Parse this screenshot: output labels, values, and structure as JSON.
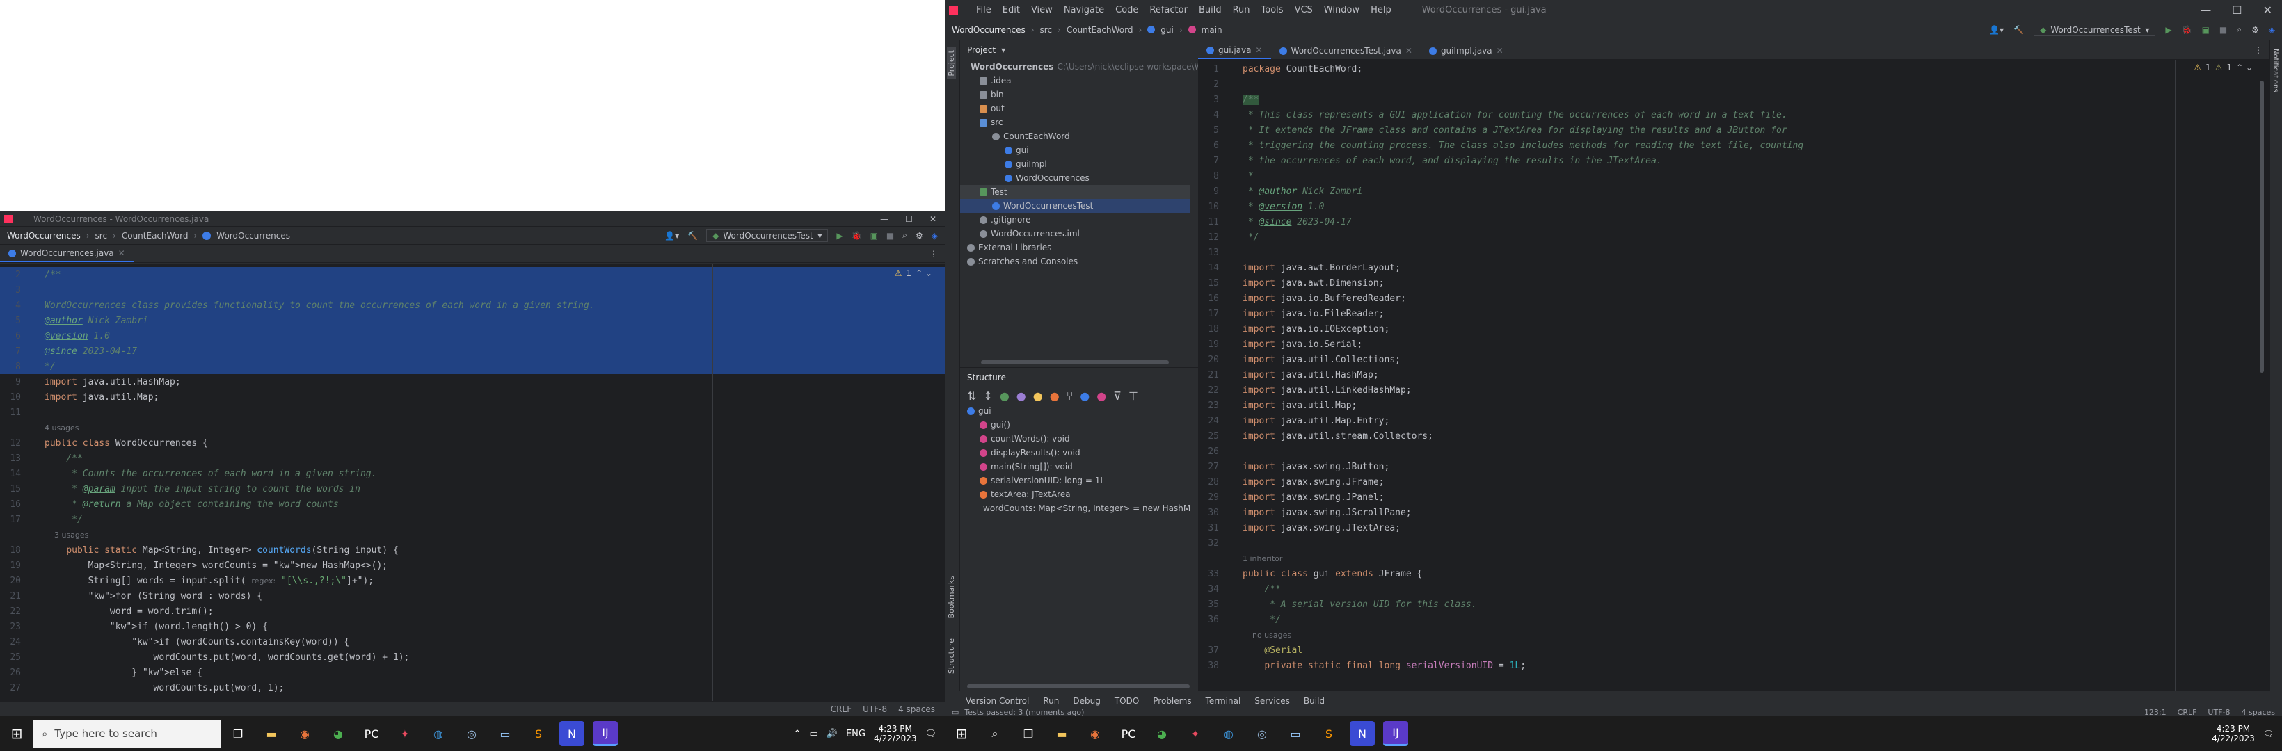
{
  "left": {
    "title": "WordOccurrences - WordOccurrences.java",
    "breadcrumb": [
      "WordOccurrences",
      "src",
      "CountEachWord",
      "WordOccurrences"
    ],
    "run_config": "WordOccurrencesTest",
    "tab": "WordOccurrences.java",
    "warnings": "1",
    "status": {
      "line_sep": "CRLF",
      "encoding": "UTF-8",
      "indent": "4 spaces"
    },
    "lines": [
      {
        "n": "2",
        "t": "/**",
        "c": "cm",
        "sel": true
      },
      {
        "n": "3",
        "t": "",
        "c": "cm",
        "sel": true
      },
      {
        "n": "4",
        "t": "WordOccurrences class provides functionality to count the occurrences of each word in a given string.",
        "c": "cm",
        "sel": true
      },
      {
        "n": "5",
        "t": "@author Nick Zambri",
        "c": "cmtag",
        "sel": true
      },
      {
        "n": "6",
        "t": "@version 1.0",
        "c": "cmtag",
        "sel": true
      },
      {
        "n": "7",
        "t": "@since 2023-04-17",
        "c": "cmtag",
        "sel": true
      },
      {
        "n": "8",
        "t": "*/",
        "c": "cm",
        "sel": true
      },
      {
        "n": "9",
        "t": "import java.util.HashMap;",
        "c": "imp"
      },
      {
        "n": "10",
        "t": "import java.util.Map;",
        "c": "imp"
      },
      {
        "n": "11",
        "t": "",
        "c": ""
      },
      {
        "n": "",
        "t": "4 usages",
        "c": "hint"
      },
      {
        "n": "12",
        "t": "public class WordOccurrences {",
        "c": "cls"
      },
      {
        "n": "13",
        "t": "    /**",
        "c": "cm"
      },
      {
        "n": "14",
        "t": "     * Counts the occurrences of each word in a given string.",
        "c": "cm"
      },
      {
        "n": "15",
        "t": "     * @param input the input string to count the words in",
        "c": "cmtag"
      },
      {
        "n": "16",
        "t": "     * @return a Map object containing the word counts",
        "c": "cmtag"
      },
      {
        "n": "17",
        "t": "     */",
        "c": "cm"
      },
      {
        "n": "",
        "t": "    3 usages",
        "c": "hint"
      },
      {
        "n": "18",
        "t": "    public static Map<String, Integer> countWords(String input) {",
        "c": "method"
      },
      {
        "n": "19",
        "t": "        Map<String, Integer> wordCounts = new HashMap<>();",
        "c": "plain"
      },
      {
        "n": "20",
        "t": "        String[] words = input.split( regex: \"[\\\\s.,?!;\\\"]+\");",
        "c": "plain"
      },
      {
        "n": "21",
        "t": "        for (String word : words) {",
        "c": "plain"
      },
      {
        "n": "22",
        "t": "            word = word.trim();",
        "c": "plain"
      },
      {
        "n": "23",
        "t": "            if (word.length() > 0) {",
        "c": "plain"
      },
      {
        "n": "24",
        "t": "                if (wordCounts.containsKey(word)) {",
        "c": "plain"
      },
      {
        "n": "25",
        "t": "                    wordCounts.put(word, wordCounts.get(word) + 1);",
        "c": "plain"
      },
      {
        "n": "26",
        "t": "                } else {",
        "c": "plain"
      },
      {
        "n": "27",
        "t": "                    wordCounts.put(word, 1);",
        "c": "plain"
      }
    ]
  },
  "left_taskbar": {
    "search_placeholder": "Type here to search",
    "lang": "ENG",
    "time": "4:23 PM",
    "date": "4/22/2023"
  },
  "right": {
    "menu": [
      "File",
      "Edit",
      "View",
      "Navigate",
      "Code",
      "Refactor",
      "Build",
      "Run",
      "Tools",
      "VCS",
      "Window",
      "Help"
    ],
    "title": "WordOccurrences - gui.java",
    "breadcrumb": [
      "WordOccurrences",
      "src",
      "CountEachWord",
      "gui",
      "main"
    ],
    "run_config": "WordOccurrencesTest",
    "project_label": "Project",
    "tabs": [
      "gui.java",
      "WordOccurrencesTest.java",
      "guiImpl.java"
    ],
    "warnings": "1",
    "weak_warnings": "1",
    "tree": [
      {
        "label": "WordOccurrences",
        "extra": "C:\\Users\\nick\\eclipse-workspace\\W",
        "indent": 0,
        "kind": "module"
      },
      {
        "label": ".idea",
        "indent": 1,
        "kind": "folder"
      },
      {
        "label": "bin",
        "indent": 1,
        "kind": "folder"
      },
      {
        "label": "out",
        "indent": 1,
        "kind": "folder-orange"
      },
      {
        "label": "src",
        "indent": 1,
        "kind": "folder-blue"
      },
      {
        "label": "CountEachWord",
        "indent": 2,
        "kind": "package"
      },
      {
        "label": "gui",
        "indent": 3,
        "kind": "class"
      },
      {
        "label": "guiImpl",
        "indent": 3,
        "kind": "class"
      },
      {
        "label": "WordOccurrences",
        "indent": 3,
        "kind": "class"
      },
      {
        "label": "Test",
        "indent": 1,
        "kind": "folder-green",
        "hl": true
      },
      {
        "label": "WordOccurrencesTest",
        "indent": 2,
        "kind": "class",
        "sel": true
      },
      {
        "label": ".gitignore",
        "indent": 1,
        "kind": "file"
      },
      {
        "label": "WordOccurrences.iml",
        "indent": 1,
        "kind": "file"
      },
      {
        "label": "External Libraries",
        "indent": 0,
        "kind": "lib"
      },
      {
        "label": "Scratches and Consoles",
        "indent": 0,
        "kind": "scratch"
      }
    ],
    "structure_label": "Structure",
    "structure": [
      {
        "label": "gui",
        "indent": 0,
        "kind": "class"
      },
      {
        "label": "gui()",
        "indent": 1,
        "kind": "m"
      },
      {
        "label": "countWords(): void",
        "indent": 1,
        "kind": "m"
      },
      {
        "label": "displayResults(): void",
        "indent": 1,
        "kind": "m"
      },
      {
        "label": "main(String[]): void",
        "indent": 1,
        "kind": "m"
      },
      {
        "label": "serialVersionUID: long = 1L",
        "indent": 1,
        "kind": "f"
      },
      {
        "label": "textArea: JTextArea",
        "indent": 1,
        "kind": "f"
      },
      {
        "label": "wordCounts: Map<String, Integer> = new HashM",
        "indent": 1,
        "kind": "f"
      }
    ],
    "lines": [
      {
        "n": "1",
        "t": "package CountEachWord;",
        "c": "pkg"
      },
      {
        "n": "2",
        "t": "",
        "c": ""
      },
      {
        "n": "3",
        "t": "/**",
        "c": "cmhl"
      },
      {
        "n": "4",
        "t": " * This class represents a GUI application for counting the occurrences of each word in a text file.",
        "c": "cm"
      },
      {
        "n": "5",
        "t": " * It extends the JFrame class and contains a JTextArea for displaying the results and a JButton for",
        "c": "cm"
      },
      {
        "n": "6",
        "t": " * triggering the counting process. The class also includes methods for reading the text file, counting",
        "c": "cm"
      },
      {
        "n": "7",
        "t": " * the occurrences of each word, and displaying the results in the JTextArea.",
        "c": "cm"
      },
      {
        "n": "8",
        "t": " *",
        "c": "cm"
      },
      {
        "n": "9",
        "t": " * @author Nick Zambri",
        "c": "cmtag"
      },
      {
        "n": "10",
        "t": " * @version 1.0",
        "c": "cmtag"
      },
      {
        "n": "11",
        "t": " * @since 2023-04-17",
        "c": "cmtag"
      },
      {
        "n": "12",
        "t": " */",
        "c": "cm"
      },
      {
        "n": "13",
        "t": "",
        "c": ""
      },
      {
        "n": "14",
        "t": "import java.awt.BorderLayout;",
        "c": "imp"
      },
      {
        "n": "15",
        "t": "import java.awt.Dimension;",
        "c": "imp"
      },
      {
        "n": "16",
        "t": "import java.io.BufferedReader;",
        "c": "imp"
      },
      {
        "n": "17",
        "t": "import java.io.FileReader;",
        "c": "imp"
      },
      {
        "n": "18",
        "t": "import java.io.IOException;",
        "c": "imp"
      },
      {
        "n": "19",
        "t": "import java.io.Serial;",
        "c": "imp"
      },
      {
        "n": "20",
        "t": "import java.util.Collections;",
        "c": "imp"
      },
      {
        "n": "21",
        "t": "import java.util.HashMap;",
        "c": "imp"
      },
      {
        "n": "22",
        "t": "import java.util.LinkedHashMap;",
        "c": "imp"
      },
      {
        "n": "23",
        "t": "import java.util.Map;",
        "c": "imp"
      },
      {
        "n": "24",
        "t": "import java.util.Map.Entry;",
        "c": "imp"
      },
      {
        "n": "25",
        "t": "import java.util.stream.Collectors;",
        "c": "imp"
      },
      {
        "n": "26",
        "t": "",
        "c": ""
      },
      {
        "n": "27",
        "t": "import javax.swing.JButton;",
        "c": "imp"
      },
      {
        "n": "28",
        "t": "import javax.swing.JFrame;",
        "c": "imp"
      },
      {
        "n": "29",
        "t": "import javax.swing.JPanel;",
        "c": "imp"
      },
      {
        "n": "30",
        "t": "import javax.swing.JScrollPane;",
        "c": "imp"
      },
      {
        "n": "31",
        "t": "import javax.swing.JTextArea;",
        "c": "imp"
      },
      {
        "n": "32",
        "t": "",
        "c": ""
      },
      {
        "n": "",
        "t": "1 inheritor",
        "c": "hint"
      },
      {
        "n": "33",
        "t": "public class gui extends JFrame {",
        "c": "cls"
      },
      {
        "n": "34",
        "t": "    /**",
        "c": "cm"
      },
      {
        "n": "35",
        "t": "     * A serial version UID for this class.",
        "c": "cm"
      },
      {
        "n": "36",
        "t": "     */",
        "c": "cm"
      },
      {
        "n": "",
        "t": "    no usages",
        "c": "hint"
      },
      {
        "n": "37",
        "t": "    @Serial",
        "c": "ann"
      },
      {
        "n": "38",
        "t": "    private static final long serialVersionUID = 1L;",
        "c": "field"
      }
    ],
    "tool_windows": [
      "Version Control",
      "Run",
      "Debug",
      "TODO",
      "Problems",
      "Terminal",
      "Services",
      "Build"
    ],
    "status_msg": "Tests passed: 3 (moments ago)",
    "status": {
      "pos": "123:1",
      "line_sep": "CRLF",
      "encoding": "UTF-8",
      "indent": "4 spaces"
    },
    "side_labels": {
      "project": "Project",
      "bookmarks": "Bookmarks",
      "structure": "Structure",
      "notifications": "Notifications"
    }
  },
  "right_taskbar": {
    "time": "4:23 PM",
    "date": "4/22/2023"
  },
  "colors": {
    "accent": "#3574f0",
    "selection": "#214283",
    "bg": "#1e1f22",
    "panel": "#2b2d30"
  }
}
